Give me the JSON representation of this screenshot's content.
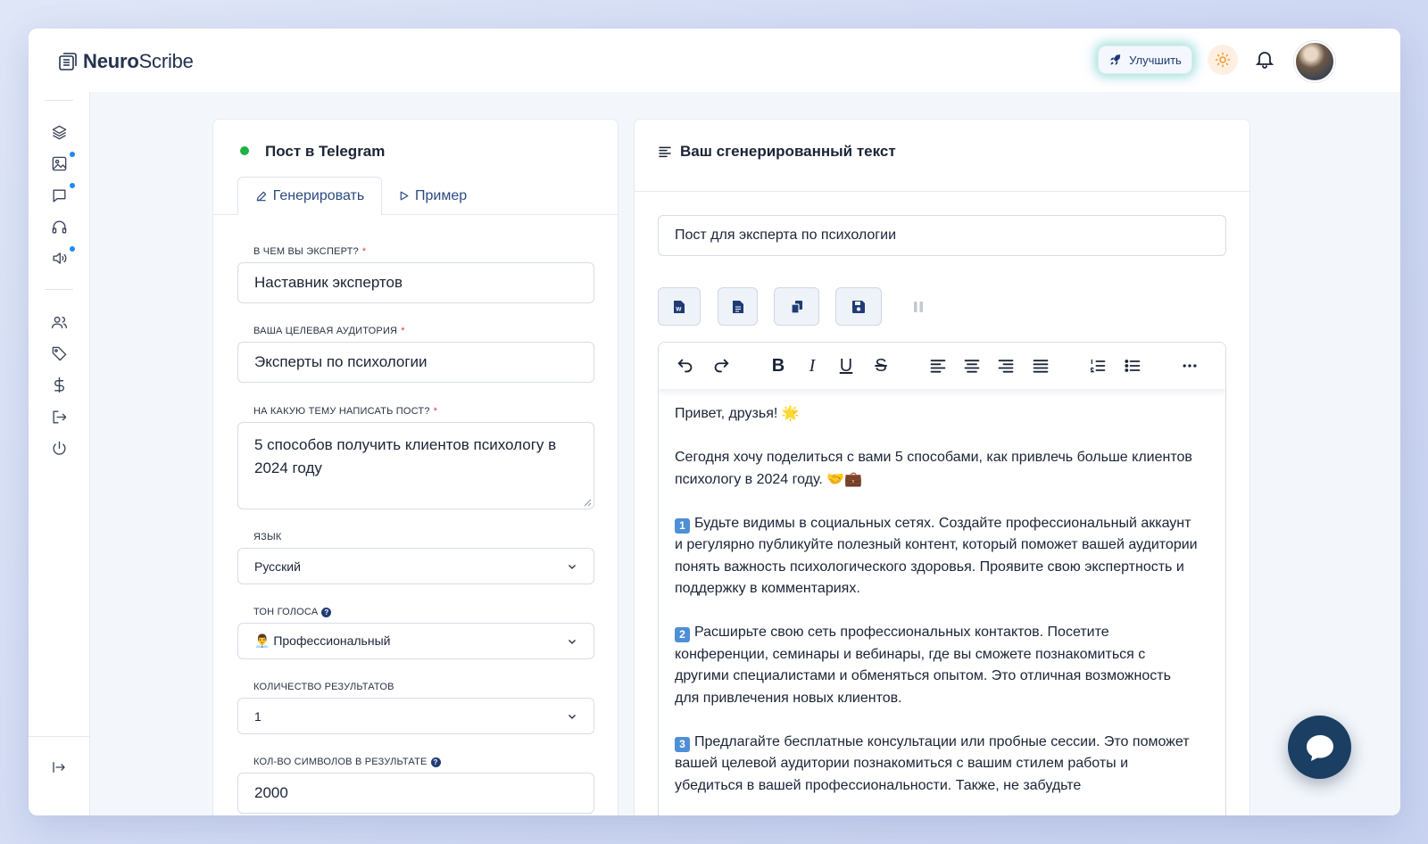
{
  "header": {
    "logo_bold": "Neuro",
    "logo_rest": "Scribe",
    "upgrade_label": "Улучшить"
  },
  "sidebar": {
    "items": [
      {
        "icon": "layers-icon",
        "badge": false
      },
      {
        "icon": "image-icon",
        "badge": true
      },
      {
        "icon": "chat-icon",
        "badge": true
      },
      {
        "icon": "headphones-icon",
        "badge": false
      },
      {
        "icon": "speaker-icon",
        "badge": true
      },
      {
        "icon": "users-icon",
        "badge": false
      },
      {
        "icon": "tag-icon",
        "badge": false
      },
      {
        "icon": "dollar-icon",
        "badge": false
      },
      {
        "icon": "logout-icon",
        "badge": false
      },
      {
        "icon": "power-icon",
        "badge": false
      }
    ],
    "collapse_icon": "expand-icon"
  },
  "left_panel": {
    "title": "Пост в Telegram",
    "tabs": {
      "generate": "Генерировать",
      "example": "Пример"
    },
    "fields": {
      "expert_label": "В чем вы эксперт?",
      "expert_value": "Наставник экспертов",
      "audience_label": "Ваша целевая аудитория",
      "audience_value": "Эксперты по психологии",
      "topic_label": "На какую тему написать пост?",
      "topic_value": "5 способов получить клиентов психологу в 2024 году",
      "language_label": "Язык",
      "language_value": "Русский",
      "tone_label": "Тон голоса",
      "tone_value": "👨‍💼 Профессиональный",
      "results_label": "Количество результатов",
      "results_value": "1",
      "chars_label": "Кол-во символов в результате",
      "chars_value": "2000"
    }
  },
  "right_panel": {
    "title": "Ваш сгенерированный текст",
    "doc_title": "Пост для эксперта по психологии",
    "content": {
      "greeting": "Привет, друзья! 🌟",
      "intro": "Сегодня хочу поделиться с вами 5 способами, как привлечь больше клиентов психологу в 2024 году. 🤝💼",
      "p1_num": "1",
      "p1": "Будьте видимы в социальных сетях. Создайте профессиональный аккаунт и регулярно публикуйте полезный контент, который поможет вашей аудитории понять важность психологического здоровья. Проявите свою экспертность и поддержку в комментариях.",
      "p2_num": "2",
      "p2": "Расширьте свою сеть профессиональных контактов. Посетите конференции, семинары и вебинары, где вы сможете познакомиться с другими специалистами и обменяться опытом. Это отличная возможность для привлечения новых клиентов.",
      "p3_num": "3",
      "p3": "Предлагайте бесплатные консультации или пробные сессии. Это поможет вашей целевой аудитории познакомиться с вашим стилем работы и убедиться в вашей профессиональности. Также, не забудьте"
    }
  }
}
